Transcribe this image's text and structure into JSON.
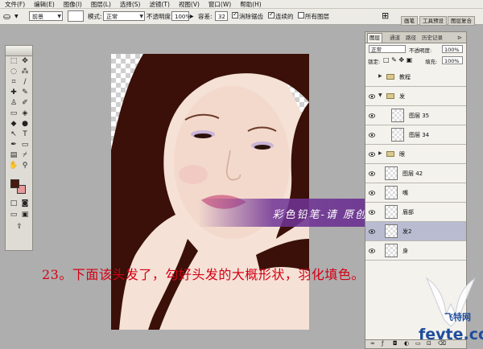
{
  "menubar": {
    "items": [
      "文件(F)",
      "编辑(E)",
      "图像(I)",
      "图层(L)",
      "选择(S)",
      "滤镜(T)",
      "视图(V)",
      "窗口(W)",
      "帮助(H)"
    ]
  },
  "options": {
    "preset": "前景",
    "mode_label": "模式:",
    "mode_value": "正常",
    "opacity_label": "不透明度:",
    "opacity_value": "100%",
    "tolerance_label": "容差:",
    "tolerance_value": "32",
    "antialias_label": "消除锯齿",
    "contiguous_label": "连续的",
    "all_layers_label": "所有图层",
    "right_tabs": [
      "画笔",
      "工具预设",
      "图层复合"
    ]
  },
  "layers_panel": {
    "tabs": [
      "图层",
      "通道",
      "路径",
      "历史记录"
    ],
    "blend_mode": "正常",
    "opacity_label": "不透明度:",
    "opacity_value": "100%",
    "lock_label": "锁定:",
    "fill_label": "填充:",
    "fill_value": "100%",
    "layers": [
      {
        "name": "教程",
        "kind": "group",
        "visible": false,
        "expanded": false,
        "indent": 0
      },
      {
        "name": "发",
        "kind": "group",
        "visible": true,
        "expanded": true,
        "indent": 0
      },
      {
        "name": "图层 35",
        "kind": "layer",
        "visible": true,
        "indent": 1
      },
      {
        "name": "图层 34",
        "kind": "layer",
        "visible": true,
        "indent": 1
      },
      {
        "name": "眼",
        "kind": "group",
        "visible": true,
        "expanded": false,
        "indent": 0
      },
      {
        "name": "图层 42",
        "kind": "layer",
        "visible": true,
        "indent": 0
      },
      {
        "name": "嘴",
        "kind": "layer",
        "visible": true,
        "indent": 0
      },
      {
        "name": "眉部",
        "kind": "layer",
        "visible": true,
        "indent": 0
      },
      {
        "name": "发2",
        "kind": "layer",
        "visible": true,
        "selected": true,
        "indent": 0
      },
      {
        "name": "身",
        "kind": "layer",
        "visible": true,
        "indent": 0
      }
    ]
  },
  "banner": {
    "text": "彩色铅笔-请  原创教程"
  },
  "caption": {
    "text": "23。下面该头发了，勾好头发的大概形状，羽化填色。"
  },
  "watermark": {
    "cn": "飞特网",
    "site": "fevte.com"
  },
  "colors": {
    "foreground": "#4a1a0c",
    "background": "#e89a9a",
    "hair": "#3a1008",
    "skin": "#f4ddd0",
    "banner": "#6e3496",
    "caption": "#d40014"
  }
}
